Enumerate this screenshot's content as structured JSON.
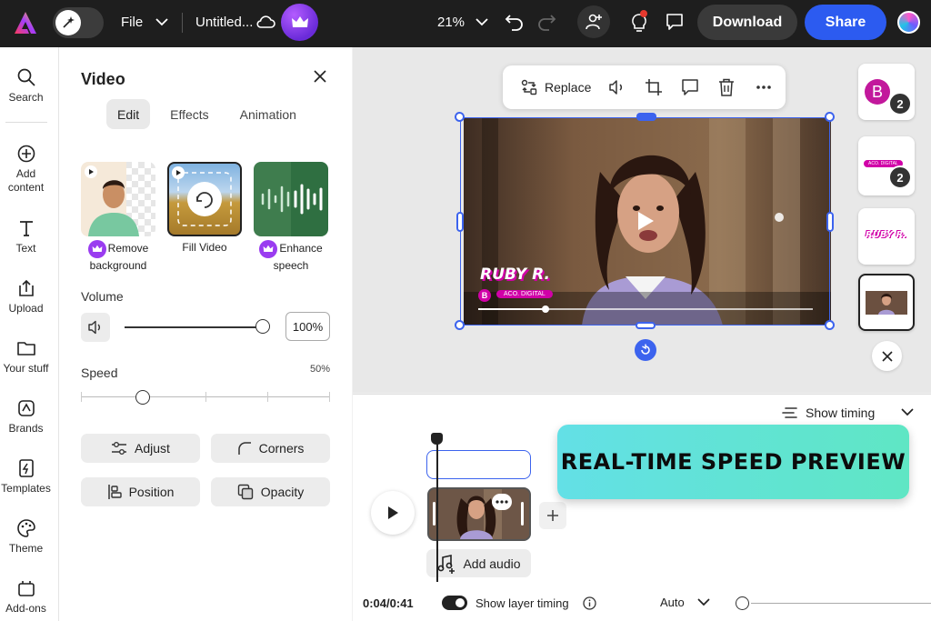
{
  "topbar": {
    "file_label": "File",
    "doc_title": "Untitled...",
    "zoom": "21%",
    "download_label": "Download",
    "share_label": "Share"
  },
  "rail": {
    "items": [
      {
        "label": "Search",
        "icon": "search-icon"
      },
      {
        "label": "Add content",
        "icon": "plus-circle-icon"
      },
      {
        "label": "Text",
        "icon": "text-icon"
      },
      {
        "label": "Upload",
        "icon": "upload-icon"
      },
      {
        "label": "Your stuff",
        "icon": "folder-icon"
      },
      {
        "label": "Brands",
        "icon": "brand-icon"
      },
      {
        "label": "Templates",
        "icon": "templates-icon"
      },
      {
        "label": "Theme",
        "icon": "palette-icon"
      },
      {
        "label": "Add-ons",
        "icon": "addons-icon"
      }
    ]
  },
  "panel": {
    "title": "Video",
    "tabs": [
      "Edit",
      "Effects",
      "Animation"
    ],
    "active_tab": "Edit",
    "features": [
      {
        "label": "Remove background",
        "premium": true
      },
      {
        "label": "Fill Video",
        "premium": false
      },
      {
        "label": "Enhance speech",
        "premium": true
      }
    ],
    "volume_label": "Volume",
    "volume_value": "100%",
    "volume_level": 1.0,
    "speed_label": "Speed",
    "speed_value": "50%",
    "buttons": {
      "adjust": "Adjust",
      "corners": "Corners",
      "position": "Position",
      "opacity": "Opacity"
    }
  },
  "canvas": {
    "toolbar": {
      "replace_label": "Replace"
    },
    "video": {
      "name_text": "RUBY R.",
      "tag_text": "ACO. DIGITAL",
      "logo_letter": "B",
      "progress": 0.2
    }
  },
  "pages": [
    {
      "badge": "2",
      "letter": "B"
    },
    {
      "badge": "2",
      "tag_text": "ACO. DIGITAL"
    },
    {
      "name_text": "RUBY R."
    },
    {
      "selected": true
    }
  ],
  "timeline": {
    "show_timing_label": "Show timing",
    "add_audio_label": "Add audio",
    "time_readout": "0:04/0:41",
    "layer_timing_label": "Show layer timing",
    "layer_timing_on": true,
    "auto_label": "Auto"
  },
  "banner": {
    "text": "REAL-TIME SPEED PREVIEW"
  },
  "colors": {
    "accent": "#2c5bf0",
    "selection": "#3c63ee",
    "brand_pink": "#d100a8",
    "premium_purple": "#9a3cf0",
    "banner_start": "#63e0e6",
    "banner_end": "#5fe6c4"
  }
}
